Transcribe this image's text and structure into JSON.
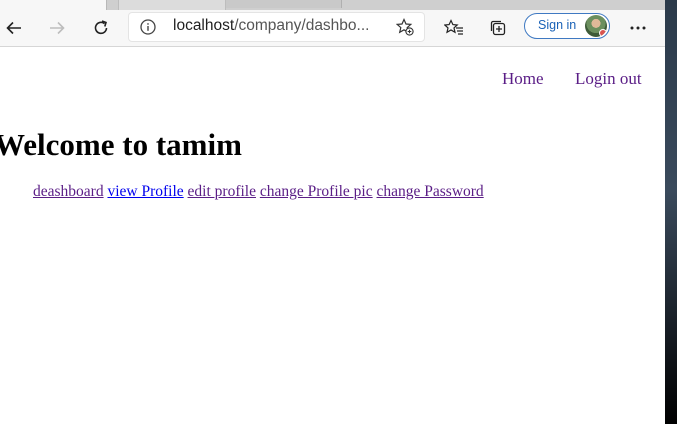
{
  "browser": {
    "address": {
      "host": "localhost",
      "path": "/company/dashbo..."
    },
    "signin_label": "Sign in",
    "icons": [
      "back-arrow-icon",
      "forward-arrow-icon",
      "refresh-icon",
      "info-icon",
      "add-favorite-icon",
      "favorites-icon",
      "collections-icon",
      "more-icon"
    ]
  },
  "nav": {
    "home": "Home",
    "logout": "Login out"
  },
  "heading": "Welcome to tamim",
  "links": {
    "dashboard": "deashboard",
    "view_profile": "view Profile",
    "edit_profile": "edit profile",
    "change_pic": "change Profile pic",
    "change_password": "change Password"
  },
  "colors": {
    "visited_link": "#5a1d86",
    "active_link": "#0000ee",
    "signin_accent": "#1a62b7"
  }
}
